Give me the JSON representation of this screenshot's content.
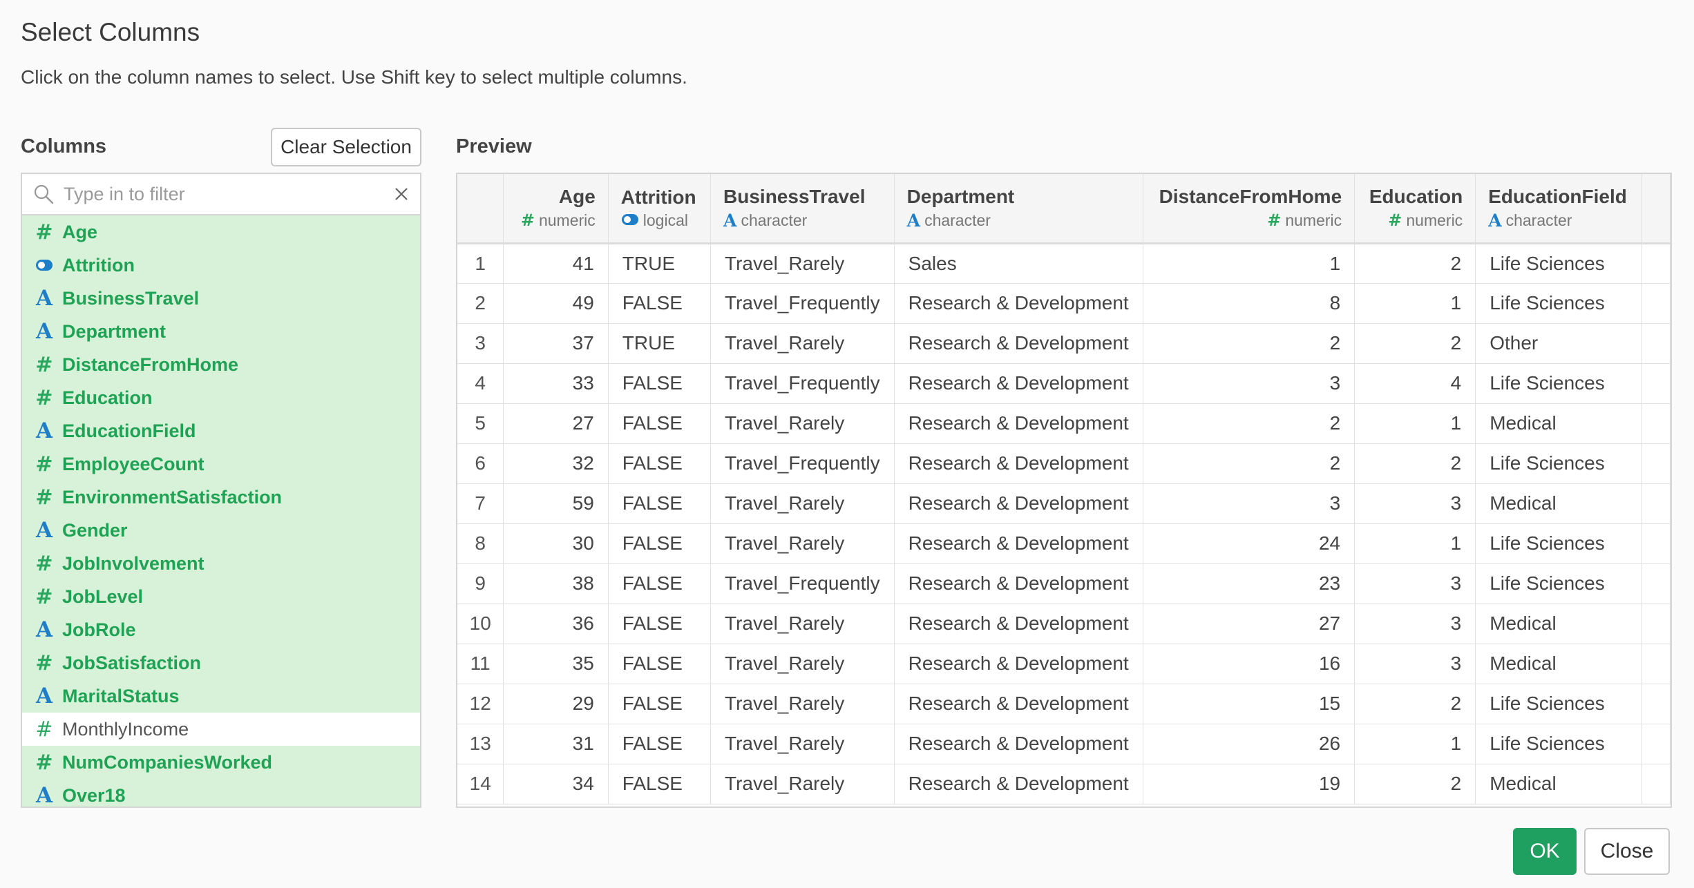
{
  "dialog": {
    "title": "Select Columns",
    "subtitle": "Click on the column names to select. Use Shift key to select multiple columns.",
    "columns_label": "Columns",
    "preview_label": "Preview",
    "clear_selection_label": "Clear Selection",
    "ok_label": "OK",
    "close_label": "Close"
  },
  "filter": {
    "placeholder": "Type in to filter",
    "value": ""
  },
  "colors": {
    "selected_bg": "#d8f2d9",
    "selected_text": "#20a255",
    "ok_button": "#1fa060",
    "character_icon": "#1e7fc8",
    "numeric_icon": "#2aa860"
  },
  "columns": [
    {
      "name": "Age",
      "type": "numeric",
      "selected": true
    },
    {
      "name": "Attrition",
      "type": "logical",
      "selected": true
    },
    {
      "name": "BusinessTravel",
      "type": "character",
      "selected": true
    },
    {
      "name": "Department",
      "type": "character",
      "selected": true
    },
    {
      "name": "DistanceFromHome",
      "type": "numeric",
      "selected": true
    },
    {
      "name": "Education",
      "type": "numeric",
      "selected": true
    },
    {
      "name": "EducationField",
      "type": "character",
      "selected": true
    },
    {
      "name": "EmployeeCount",
      "type": "numeric",
      "selected": true
    },
    {
      "name": "EnvironmentSatisfaction",
      "type": "numeric",
      "selected": true
    },
    {
      "name": "Gender",
      "type": "character",
      "selected": true
    },
    {
      "name": "JobInvolvement",
      "type": "numeric",
      "selected": true
    },
    {
      "name": "JobLevel",
      "type": "numeric",
      "selected": true
    },
    {
      "name": "JobRole",
      "type": "character",
      "selected": true
    },
    {
      "name": "JobSatisfaction",
      "type": "numeric",
      "selected": true
    },
    {
      "name": "MaritalStatus",
      "type": "character",
      "selected": true
    },
    {
      "name": "MonthlyIncome",
      "type": "numeric",
      "selected": false
    },
    {
      "name": "NumCompaniesWorked",
      "type": "numeric",
      "selected": true
    },
    {
      "name": "Over18",
      "type": "character",
      "selected": true
    }
  ],
  "preview": {
    "headers": [
      {
        "name": "Age",
        "type": "numeric",
        "align": "right"
      },
      {
        "name": "Attrition",
        "type": "logical",
        "align": "left"
      },
      {
        "name": "BusinessTravel",
        "type": "character",
        "align": "left"
      },
      {
        "name": "Department",
        "type": "character",
        "align": "left"
      },
      {
        "name": "DistanceFromHome",
        "type": "numeric",
        "align": "right"
      },
      {
        "name": "Education",
        "type": "numeric",
        "align": "right"
      },
      {
        "name": "EducationField",
        "type": "character",
        "align": "left"
      }
    ],
    "rows": [
      [
        "1",
        "41",
        "TRUE",
        "Travel_Rarely",
        "Sales",
        "1",
        "2",
        "Life Sciences"
      ],
      [
        "2",
        "49",
        "FALSE",
        "Travel_Frequently",
        "Research & Development",
        "8",
        "1",
        "Life Sciences"
      ],
      [
        "3",
        "37",
        "TRUE",
        "Travel_Rarely",
        "Research & Development",
        "2",
        "2",
        "Other"
      ],
      [
        "4",
        "33",
        "FALSE",
        "Travel_Frequently",
        "Research & Development",
        "3",
        "4",
        "Life Sciences"
      ],
      [
        "5",
        "27",
        "FALSE",
        "Travel_Rarely",
        "Research & Development",
        "2",
        "1",
        "Medical"
      ],
      [
        "6",
        "32",
        "FALSE",
        "Travel_Frequently",
        "Research & Development",
        "2",
        "2",
        "Life Sciences"
      ],
      [
        "7",
        "59",
        "FALSE",
        "Travel_Rarely",
        "Research & Development",
        "3",
        "3",
        "Medical"
      ],
      [
        "8",
        "30",
        "FALSE",
        "Travel_Rarely",
        "Research & Development",
        "24",
        "1",
        "Life Sciences"
      ],
      [
        "9",
        "38",
        "FALSE",
        "Travel_Frequently",
        "Research & Development",
        "23",
        "3",
        "Life Sciences"
      ],
      [
        "10",
        "36",
        "FALSE",
        "Travel_Rarely",
        "Research & Development",
        "27",
        "3",
        "Medical"
      ],
      [
        "11",
        "35",
        "FALSE",
        "Travel_Rarely",
        "Research & Development",
        "16",
        "3",
        "Medical"
      ],
      [
        "12",
        "29",
        "FALSE",
        "Travel_Rarely",
        "Research & Development",
        "15",
        "2",
        "Life Sciences"
      ],
      [
        "13",
        "31",
        "FALSE",
        "Travel_Rarely",
        "Research & Development",
        "26",
        "1",
        "Life Sciences"
      ],
      [
        "14",
        "34",
        "FALSE",
        "Travel_Rarely",
        "Research & Development",
        "19",
        "2",
        "Medical"
      ]
    ]
  }
}
